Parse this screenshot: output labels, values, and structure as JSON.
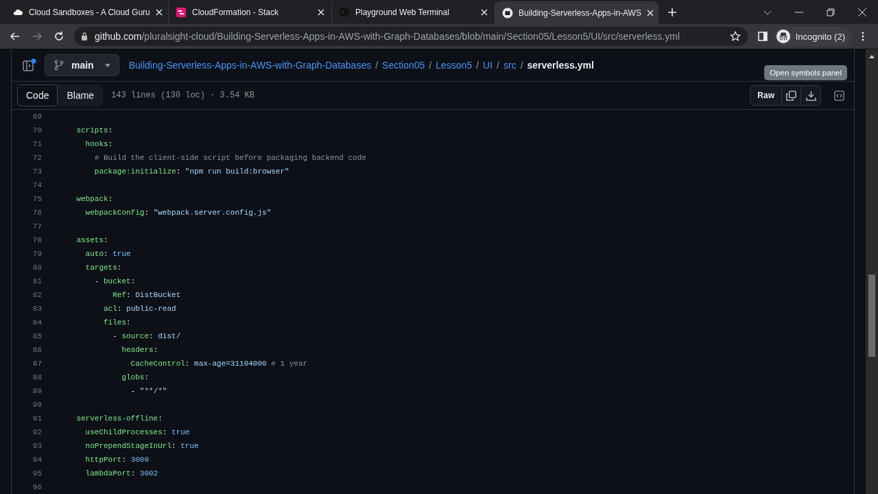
{
  "browser": {
    "tabs": [
      {
        "title": "Cloud Sandboxes - A Cloud Guru",
        "kind": "cloud",
        "selected": false
      },
      {
        "title": "CloudFormation - Stack",
        "kind": "stack",
        "selected": false
      },
      {
        "title": "Playground Web Terminal",
        "kind": "terminal",
        "selected": false
      },
      {
        "title": "Building-Serverless-Apps-in-AWS",
        "kind": "github",
        "selected": true
      }
    ],
    "address": {
      "domain": "github.com",
      "path": "/pluralsight-cloud/Building-Serverless-Apps-in-AWS-with-Graph-Databases/blob/main/Section05/Lesson5/UI/src/serverless.yml"
    },
    "profile": "Incognito (2)"
  },
  "repo_header": {
    "branch": "main",
    "breadcrumb": [
      {
        "text": "Building-Serverless-Apps-in-AWS-with-Graph-Databases",
        "kind": "link"
      },
      {
        "text": "/",
        "kind": "separator"
      },
      {
        "text": "Section05",
        "kind": "link"
      },
      {
        "text": "/",
        "kind": "separator"
      },
      {
        "text": "Lesson5",
        "kind": "link"
      },
      {
        "text": "/",
        "kind": "separator"
      },
      {
        "text": "UI",
        "kind": "link"
      },
      {
        "text": "/",
        "kind": "separator"
      },
      {
        "text": "src",
        "kind": "link"
      },
      {
        "text": "/",
        "kind": "separator"
      },
      {
        "text": "serverless.yml",
        "kind": "current"
      }
    ],
    "tooltip": "Open symbols panel"
  },
  "file_toolbar": {
    "tabs": [
      {
        "label": "Code",
        "selected": true
      },
      {
        "label": "Blame",
        "selected": false
      }
    ],
    "meta": "143 lines (130 loc) · 3.54 KB",
    "raw_button": "Raw"
  },
  "code_lines": [
    {
      "number": "69"
    },
    {
      "number": "70",
      "tokens": [
        {
          "kind": "key",
          "text": "    scripts"
        },
        {
          "kind": "plain",
          "text": ":"
        }
      ]
    },
    {
      "number": "71",
      "tokens": [
        {
          "kind": "key",
          "text": "      hooks"
        },
        {
          "kind": "plain",
          "text": ":"
        }
      ]
    },
    {
      "number": "72",
      "tokens": [
        {
          "kind": "comment",
          "text": "        # Build the client-side script before packaging backend code"
        }
      ]
    },
    {
      "number": "73",
      "tokens": [
        {
          "kind": "key",
          "text": "        package:initialize"
        },
        {
          "kind": "plain",
          "text": ": "
        },
        {
          "kind": "string",
          "text": "\"npm run build:browser\""
        }
      ]
    },
    {
      "number": "74"
    },
    {
      "number": "75",
      "tokens": [
        {
          "kind": "key",
          "text": "    webpack"
        },
        {
          "kind": "plain",
          "text": ":"
        }
      ]
    },
    {
      "number": "76",
      "tokens": [
        {
          "kind": "key",
          "text": "      webpackConfig"
        },
        {
          "kind": "plain",
          "text": ": "
        },
        {
          "kind": "string",
          "text": "\"webpack.server.config.js\""
        }
      ]
    },
    {
      "number": "77"
    },
    {
      "number": "78",
      "tokens": [
        {
          "kind": "key",
          "text": "    assets"
        },
        {
          "kind": "plain",
          "text": ":"
        }
      ]
    },
    {
      "number": "79",
      "tokens": [
        {
          "kind": "key",
          "text": "      auto"
        },
        {
          "kind": "plain",
          "text": ": "
        },
        {
          "kind": "constant",
          "text": "true"
        }
      ]
    },
    {
      "number": "80",
      "tokens": [
        {
          "kind": "key",
          "text": "      targets"
        },
        {
          "kind": "plain",
          "text": ":"
        }
      ]
    },
    {
      "number": "81",
      "tokens": [
        {
          "kind": "plain",
          "text": "        - "
        },
        {
          "kind": "key",
          "text": "bucket"
        },
        {
          "kind": "plain",
          "text": ":"
        }
      ]
    },
    {
      "number": "82",
      "tokens": [
        {
          "kind": "key",
          "text": "            Ref"
        },
        {
          "kind": "plain",
          "text": ": "
        },
        {
          "kind": "string",
          "text": "DistBucket"
        }
      ]
    },
    {
      "number": "83",
      "tokens": [
        {
          "kind": "key",
          "text": "          acl"
        },
        {
          "kind": "plain",
          "text": ": "
        },
        {
          "kind": "string",
          "text": "public-read"
        }
      ]
    },
    {
      "number": "84",
      "tokens": [
        {
          "kind": "key",
          "text": "          files"
        },
        {
          "kind": "plain",
          "text": ":"
        }
      ]
    },
    {
      "number": "85",
      "tokens": [
        {
          "kind": "plain",
          "text": "            - "
        },
        {
          "kind": "key",
          "text": "source"
        },
        {
          "kind": "plain",
          "text": ": "
        },
        {
          "kind": "string",
          "text": "dist/"
        }
      ]
    },
    {
      "number": "86",
      "tokens": [
        {
          "kind": "key",
          "text": "              headers"
        },
        {
          "kind": "plain",
          "text": ":"
        }
      ]
    },
    {
      "number": "87",
      "tokens": [
        {
          "kind": "key",
          "text": "                CacheControl"
        },
        {
          "kind": "plain",
          "text": ": "
        },
        {
          "kind": "string",
          "text": "max-age=31104000"
        },
        {
          "kind": "comment",
          "text": " # 1 year"
        }
      ]
    },
    {
      "number": "88",
      "tokens": [
        {
          "kind": "key",
          "text": "              globs"
        },
        {
          "kind": "plain",
          "text": ":"
        }
      ]
    },
    {
      "number": "89",
      "tokens": [
        {
          "kind": "plain",
          "text": "                - "
        },
        {
          "kind": "string",
          "text": "\"**/*\""
        }
      ]
    },
    {
      "number": "90"
    },
    {
      "number": "91",
      "tokens": [
        {
          "kind": "key",
          "text": "    serverless-offline"
        },
        {
          "kind": "plain",
          "text": ":"
        }
      ]
    },
    {
      "number": "92",
      "tokens": [
        {
          "kind": "key",
          "text": "      useChildProcesses"
        },
        {
          "kind": "plain",
          "text": ": "
        },
        {
          "kind": "constant",
          "text": "true"
        }
      ]
    },
    {
      "number": "93",
      "tokens": [
        {
          "kind": "key",
          "text": "      noPrependStageInUrl"
        },
        {
          "kind": "plain",
          "text": ": "
        },
        {
          "kind": "constant",
          "text": "true"
        }
      ]
    },
    {
      "number": "94",
      "tokens": [
        {
          "kind": "key",
          "text": "      httpPort"
        },
        {
          "kind": "plain",
          "text": ": "
        },
        {
          "kind": "constant",
          "text": "3000"
        }
      ]
    },
    {
      "number": "95",
      "tokens": [
        {
          "kind": "key",
          "text": "      lambdaPort"
        },
        {
          "kind": "plain",
          "text": ": "
        },
        {
          "kind": "constant",
          "text": "3002"
        }
      ]
    },
    {
      "number": "96"
    }
  ]
}
